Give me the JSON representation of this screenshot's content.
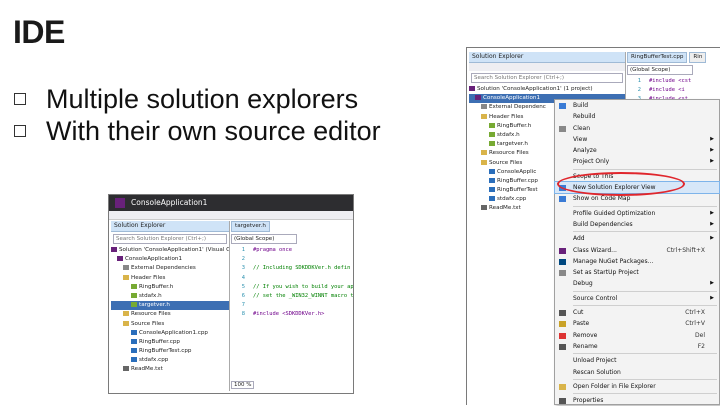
{
  "slide": {
    "title": "IDE",
    "bullets": [
      "Multiple solution explorers",
      "With their own source editor"
    ]
  },
  "shot1": {
    "window_title": "ConsoleApplication1",
    "explorer": {
      "header": "Solution Explorer",
      "search_placeholder": "Search Solution Explorer (Ctrl+;)",
      "tree": [
        "Solution 'ConsoleApplication1' (Visual C++ Co",
        "ConsoleApplication1",
        "External Dependencies",
        "Header Files",
        "RingBuffer.h",
        "stdafx.h",
        "targetver.h",
        "Resource Files",
        "Source Files",
        "ConsoleApplication1.cpp",
        "RingBuffer.cpp",
        "RingBufferTest.cpp",
        "stdafx.cpp",
        "ReadMe.txt"
      ]
    },
    "editor": {
      "tab": "targetver.h",
      "scope": "(Global Scope)",
      "lines": [
        {
          "n": "1",
          "text": "#pragma once"
        },
        {
          "n": "2",
          "text": ""
        },
        {
          "n": "3",
          "text": "// Including SDKDDKVer.h defin"
        },
        {
          "n": "4",
          "text": ""
        },
        {
          "n": "5",
          "text": "// If you wish to build your ap"
        },
        {
          "n": "6",
          "text": "// set the _WIN32_WINNT macro t"
        },
        {
          "n": "7",
          "text": ""
        },
        {
          "n": "8",
          "text": "#include <SDKDDKVer.h>"
        }
      ],
      "zoom": "100 %"
    }
  },
  "shot2": {
    "explorer": {
      "header": "Solution Explorer",
      "search_placeholder": "Search Solution Explorer (Ctrl+;)",
      "tree": [
        "Solution 'ConsoleApplication1' (1 project)",
        "ConsoleApplication1",
        "External Dependenc",
        "Header Files",
        "RingBuffer.h",
        "stdafx.h",
        "targetver.h",
        "Resource Files",
        "Source Files",
        "ConsoleApplic",
        "RingBuffer.cpp",
        "RingBufferTest",
        "stdafx.cpp",
        "ReadMe.txt"
      ]
    },
    "editor": {
      "tab": "RingBufferTest.cpp",
      "tab2": "Rin",
      "scope": "(Global Scope)",
      "lines": [
        {
          "n": "1",
          "text": "#include <cst"
        },
        {
          "n": "2",
          "text": "#include <i"
        },
        {
          "n": "3",
          "text": "#include <st"
        }
      ]
    },
    "context_menu": {
      "items": [
        {
          "label": "Build",
          "sc": "",
          "arrow": false
        },
        {
          "label": "Rebuild",
          "sc": "",
          "arrow": false
        },
        {
          "label": "Clean",
          "sc": "",
          "arrow": false
        },
        {
          "label": "View",
          "sc": "",
          "arrow": true
        },
        {
          "label": "Analyze",
          "sc": "",
          "arrow": true
        },
        {
          "label": "Project Only",
          "sc": "",
          "arrow": true
        },
        {
          "label": "Scope to This",
          "sc": "",
          "arrow": false,
          "sep_before": true
        },
        {
          "label": "New Solution Explorer View",
          "sc": "",
          "arrow": false,
          "highlight": true
        },
        {
          "label": "Show on Code Map",
          "sc": "",
          "arrow": false
        },
        {
          "label": "Profile Guided Optimization",
          "sc": "",
          "arrow": true,
          "sep_before": true
        },
        {
          "label": "Build Dependencies",
          "sc": "",
          "arrow": true
        },
        {
          "label": "Add",
          "sc": "",
          "arrow": true,
          "sep_before": true
        },
        {
          "label": "Class Wizard...",
          "sc": "Ctrl+Shift+X",
          "arrow": false
        },
        {
          "label": "Manage NuGet Packages...",
          "sc": "",
          "arrow": false
        },
        {
          "label": "Set as StartUp Project",
          "sc": "",
          "arrow": false
        },
        {
          "label": "Debug",
          "sc": "",
          "arrow": true
        },
        {
          "label": "Source Control",
          "sc": "",
          "arrow": true,
          "sep_before": true
        },
        {
          "label": "Cut",
          "sc": "Ctrl+X",
          "arrow": false,
          "sep_before": true
        },
        {
          "label": "Paste",
          "sc": "Ctrl+V",
          "arrow": false
        },
        {
          "label": "Remove",
          "sc": "Del",
          "arrow": false
        },
        {
          "label": "Rename",
          "sc": "F2",
          "arrow": false
        },
        {
          "label": "Unload Project",
          "sc": "",
          "arrow": false,
          "sep_before": true
        },
        {
          "label": "Rescan Solution",
          "sc": "",
          "arrow": false
        },
        {
          "label": "Open Folder in File Explorer",
          "sc": "",
          "arrow": false,
          "sep_before": true
        },
        {
          "label": "Properties",
          "sc": "",
          "arrow": false,
          "sep_before": true
        }
      ]
    }
  },
  "colors": {
    "accent_blue": "#cfe3f7",
    "selection": "#3d6fb3",
    "highlight_ring": "#e0262c",
    "vs_purple": "#68217a"
  }
}
